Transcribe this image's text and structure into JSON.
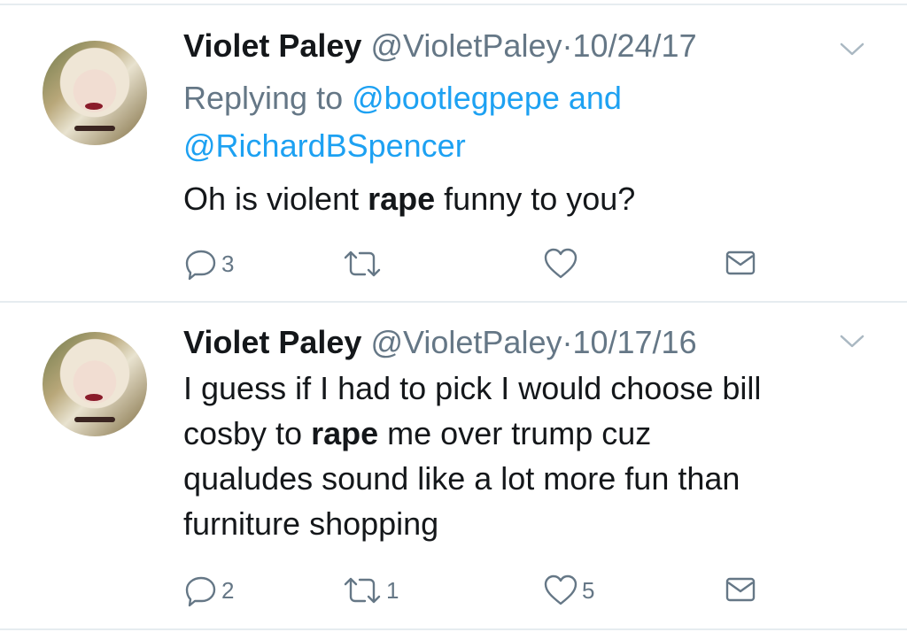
{
  "tweets": [
    {
      "name": "Violet Paley",
      "handle": "@VioletPaley",
      "separator": "·",
      "date": "10/24/17",
      "replying_prefix": "Replying to",
      "replying_user1": "@bootlegpepe",
      "replying_and": "and",
      "replying_user2": "@RichardBSpencer",
      "text_before": "Oh is violent",
      "text_bold": "rape",
      "text_after": "funny to you?",
      "reply_count": "3",
      "retweet_count": "",
      "like_count": ""
    },
    {
      "name": "Violet Paley",
      "handle": "@VioletPaley",
      "separator": "·",
      "date": "10/17/16",
      "text_line1": "I guess if I had to pick I would choose bill",
      "text_line2_before": "cosby to",
      "text_bold": "rape",
      "text_line2_after": "me over trump cuz",
      "text_line3": "qualudes sound like a lot more fun than",
      "text_line4": "furniture shopping",
      "reply_count": "2",
      "retweet_count": "1",
      "like_count": "5"
    }
  ],
  "icons": {
    "reply": "reply-icon",
    "retweet": "retweet-icon",
    "like": "heart-icon",
    "dm": "envelope-icon",
    "menu": "chevron-down-icon"
  },
  "colors": {
    "link": "#1da1f2",
    "secondary": "#657786",
    "text": "#14171a",
    "divider": "#e6ecf0"
  }
}
